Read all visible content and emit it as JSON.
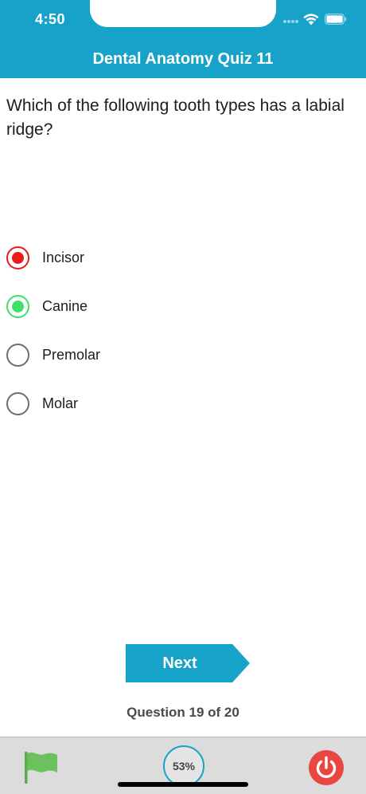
{
  "status_bar": {
    "time": "4:50"
  },
  "nav": {
    "title": "Dental Anatomy Quiz 11"
  },
  "question": {
    "text": "Which of the following tooth types has a labial ridge?"
  },
  "options": [
    {
      "label": "Incisor",
      "state": "wrong"
    },
    {
      "label": "Canine",
      "state": "correct"
    },
    {
      "label": "Premolar",
      "state": "none"
    },
    {
      "label": "Molar",
      "state": "none"
    }
  ],
  "next_button": {
    "label": "Next"
  },
  "progress": {
    "text": "Question 19 of 20"
  },
  "bottom_bar": {
    "score_percent": "53%",
    "flag_icon": "flag-icon",
    "power_icon": "power-icon"
  },
  "colors": {
    "accent": "#17a2c9",
    "wrong": "#e81c1c",
    "correct": "#3ee06a",
    "flag": "#6cc15f",
    "power": "#e8463f"
  }
}
